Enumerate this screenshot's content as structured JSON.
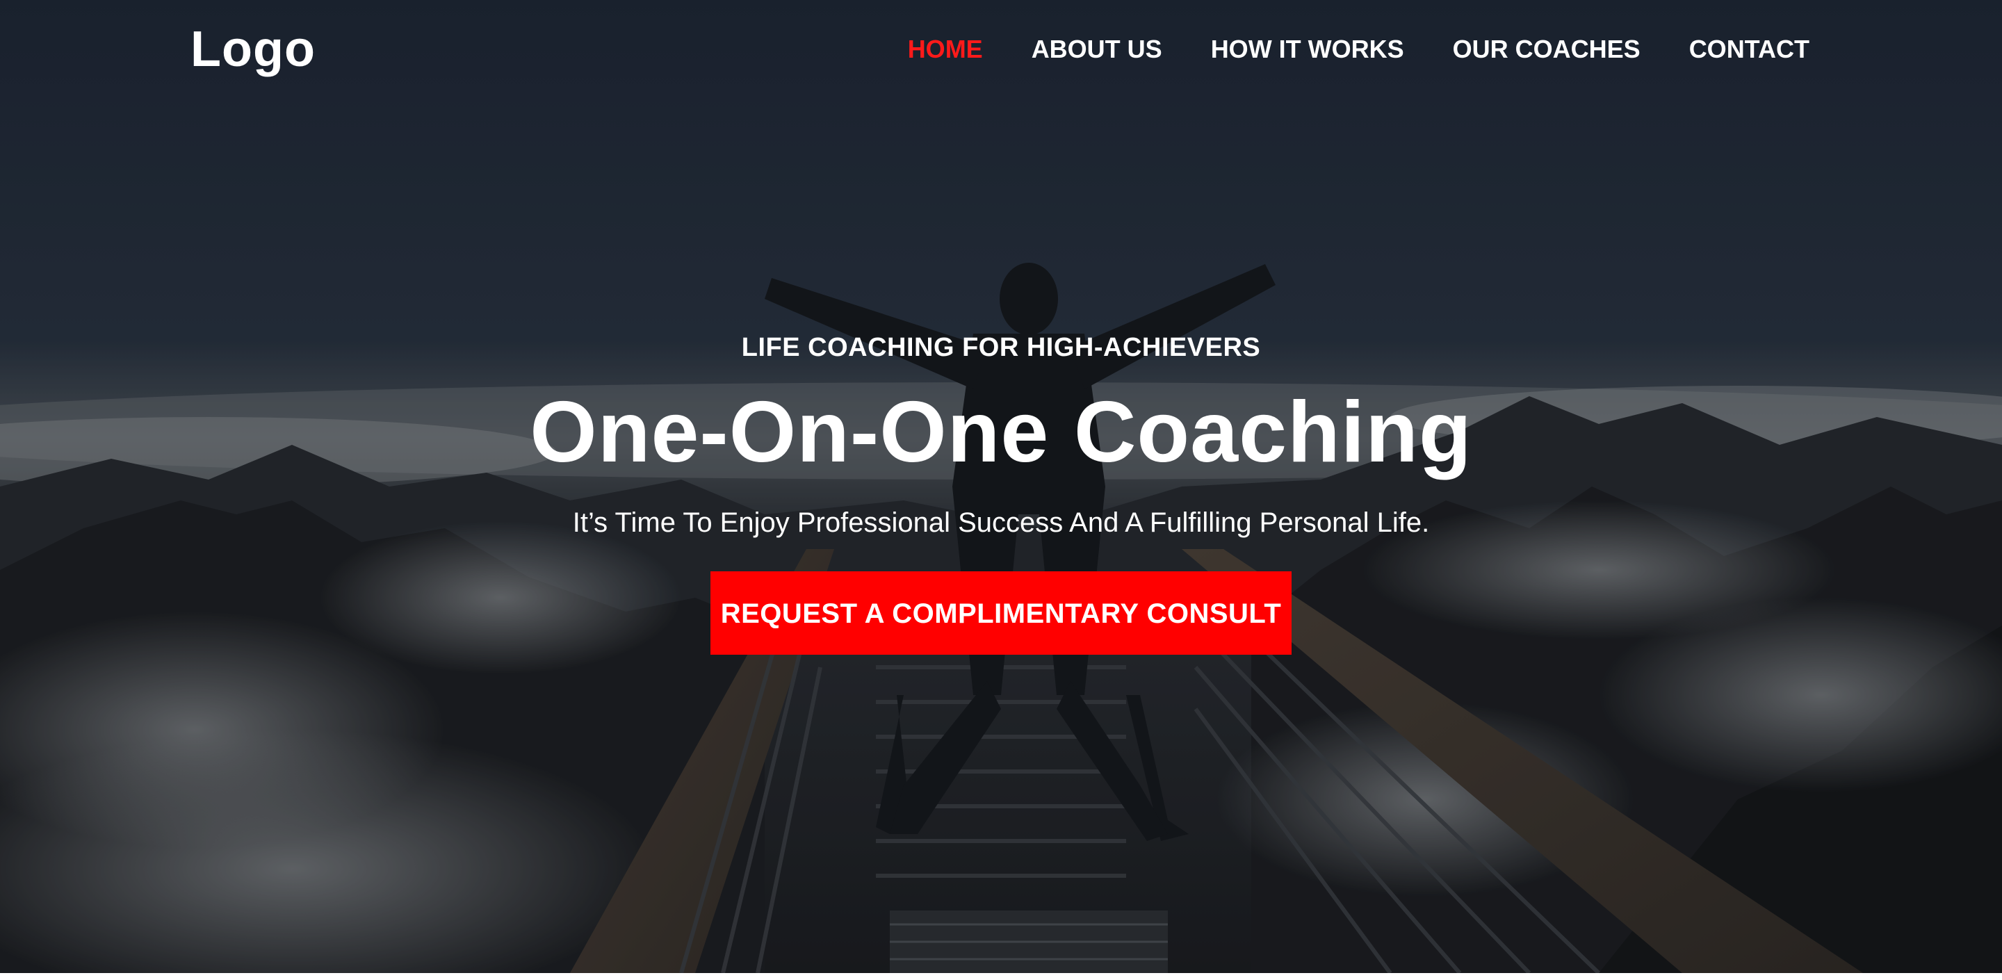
{
  "header": {
    "logo": "Logo",
    "nav": [
      {
        "label": "HOME",
        "active": true
      },
      {
        "label": "ABOUT US",
        "active": false
      },
      {
        "label": "HOW IT WORKS",
        "active": false
      },
      {
        "label": "OUR COACHES",
        "active": false
      },
      {
        "label": "CONTACT",
        "active": false
      }
    ]
  },
  "hero": {
    "eyebrow": "LIFE COACHING FOR HIGH-ACHIEVERS",
    "headline": "One-On-One Coaching",
    "subhead": "It’s Time To Enjoy Professional Success And A Fulfilling Personal Life.",
    "cta_label": "REQUEST A COMPLIMENTARY CONSULT",
    "background_description_icon": "mountain-bridge-photo"
  },
  "colors": {
    "accent": "#ff0000",
    "nav_active": "#ff1a1a",
    "text": "#ffffff",
    "sky_dark": "#1e2634"
  }
}
